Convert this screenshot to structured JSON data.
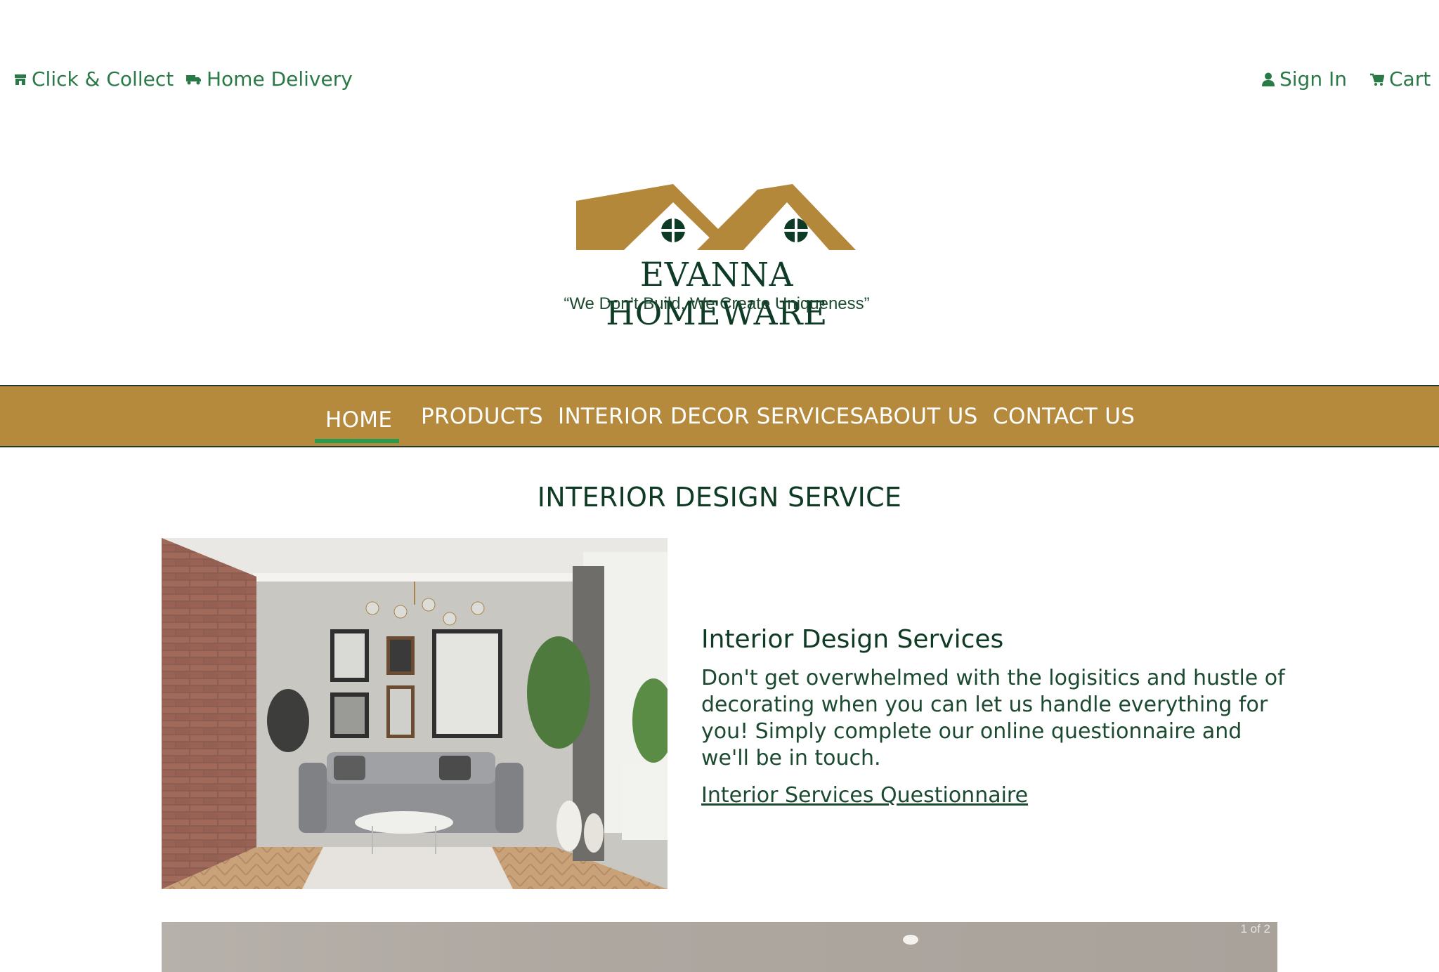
{
  "utility": {
    "click_collect": "Click & Collect",
    "home_delivery": "Home Delivery",
    "sign_in": "Sign In",
    "cart": "Cart"
  },
  "logo": {
    "name": "EVANNA HOMEWARE",
    "tagline": "“We Don’t Build, We Create Uniqueness”"
  },
  "nav": {
    "items": [
      "HOME",
      "PRODUCTS",
      "INTERIOR DECOR SERVICES",
      "ABOUT US",
      "CONTACT US"
    ],
    "active": "HOME"
  },
  "main": {
    "section_title": "INTERIOR DESIGN SERVICE",
    "heading": "Interior Design Services",
    "body": "Don't get overwhelmed with the logisitics and hustle of decorating when you can let us handle everything for you! Simply complete our online questionnaire and we'll be in touch.",
    "link": "Interior Services Questionnaire",
    "carousel_counter": "1 of 2"
  },
  "colors": {
    "nav_bg": "#b58a3c",
    "brand_green": "#0e3b26",
    "accent_green": "#2a9a4e",
    "logo_gold": "#b4883b"
  }
}
